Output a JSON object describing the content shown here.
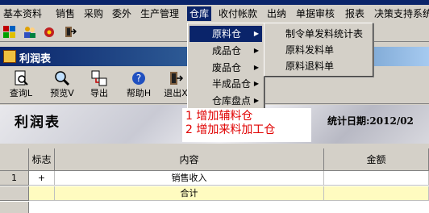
{
  "menubar": {
    "items": [
      "基本资料",
      "销售",
      "采购",
      "委外",
      "生产管理",
      "仓库",
      "收付帐款",
      "出纳",
      "单据审核",
      "报表",
      "决策支持系统"
    ]
  },
  "window": {
    "title": "利润表"
  },
  "toolbar": {
    "buttons": [
      "查询L",
      "预览V",
      "导出",
      "帮助H",
      "退出X"
    ]
  },
  "banner": {
    "title": "利润表",
    "date_label": "统计日期:2012/02"
  },
  "grid": {
    "headers": [
      "标志",
      "内容",
      "金额"
    ],
    "rows": [
      {
        "num": "1",
        "flag": "+",
        "content": "销售收入",
        "amount": ""
      }
    ],
    "total_label": "合计"
  },
  "menu_warehouse": {
    "items": [
      "原料仓",
      "成品仓",
      "废品仓",
      "半成品仓",
      "仓库盘点"
    ]
  },
  "submenu_raw": {
    "items": [
      "制令单发料统计表",
      "原料发料单",
      "原料退料单"
    ]
  },
  "annotation": {
    "lines": [
      "1 增加辅料仓",
      "2 增加来料加工仓"
    ]
  }
}
